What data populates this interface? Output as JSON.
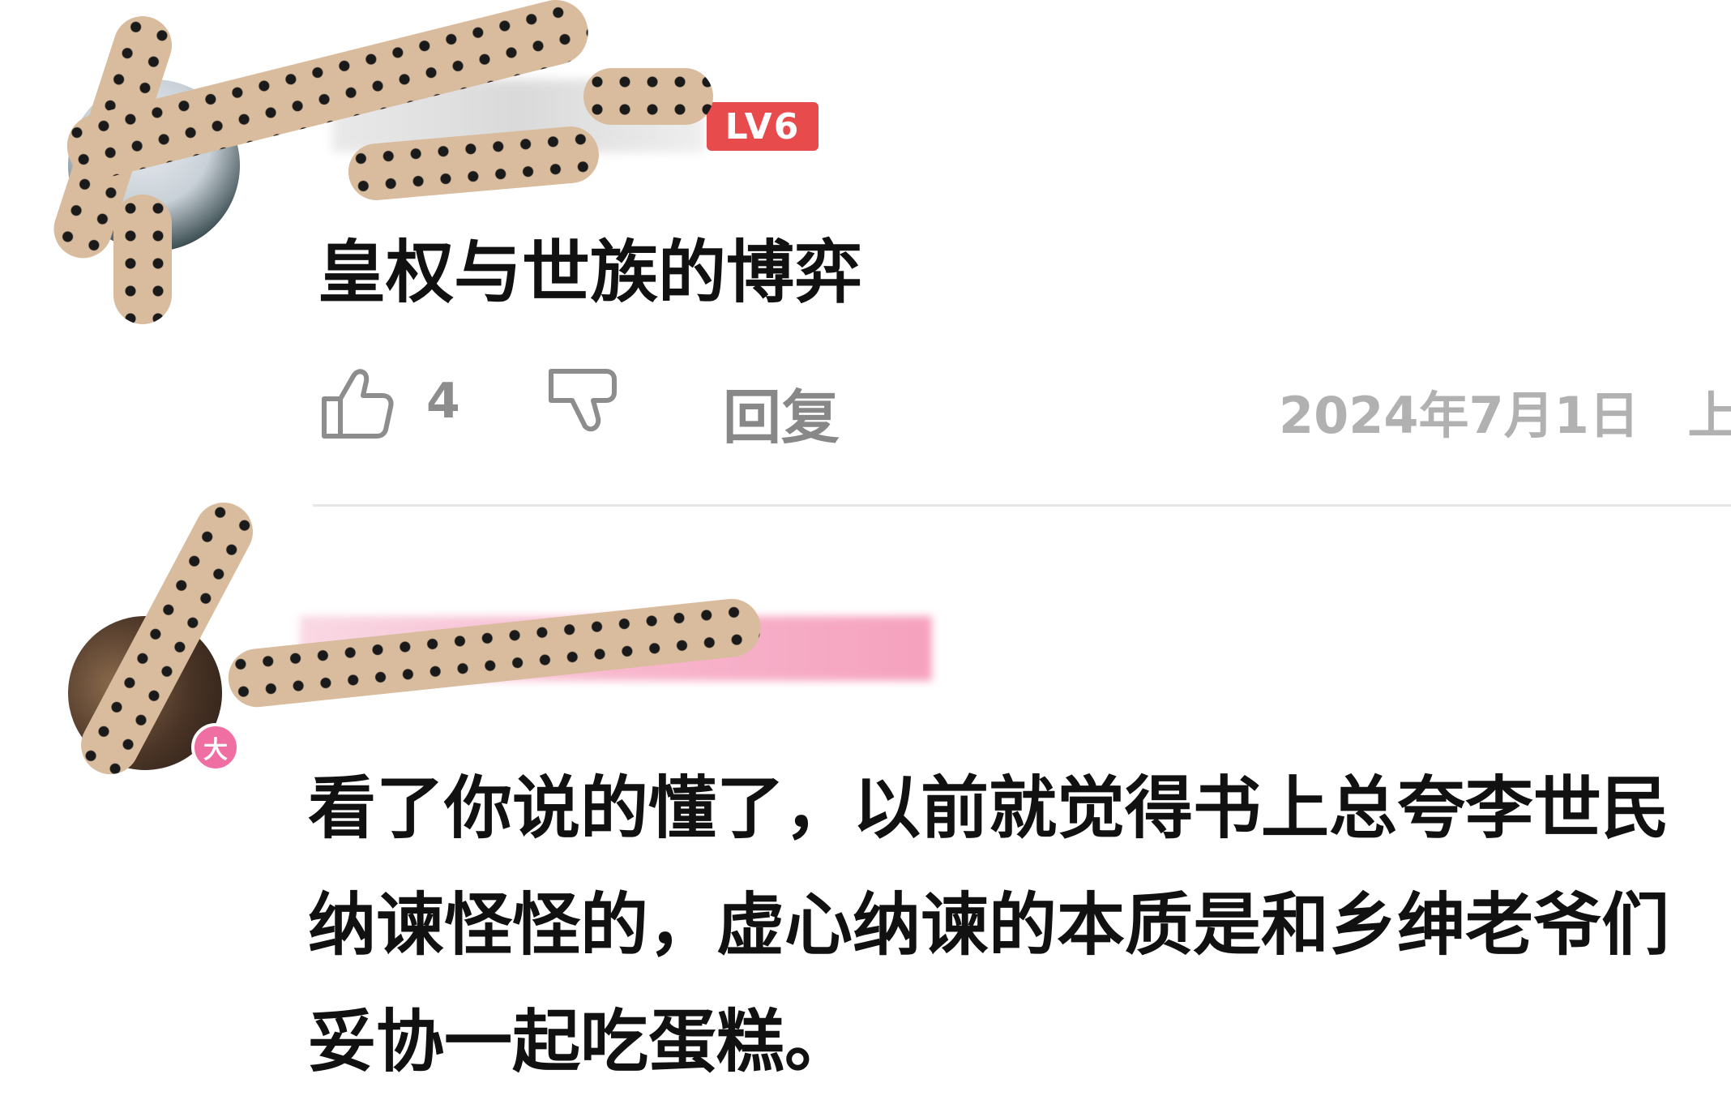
{
  "comment_1": {
    "author_level": "LV6",
    "text": "皇权与世族的博弈",
    "like_count": "4",
    "reply_label": "回复",
    "date": "2024年7月1日",
    "location": "上海"
  },
  "comment_2": {
    "avatar_badge": "大",
    "text": "看了你说的懂了，以前就觉得书上总夸李世民纳谏怪怪的，虚心纳谏的本质是和乡绅老爷们妥协一起吃蛋糕。"
  },
  "colors": {
    "level_badge": "#e84b4b",
    "avatar_badge": "#f06fa3",
    "meta_text": "#b1b1b1"
  }
}
